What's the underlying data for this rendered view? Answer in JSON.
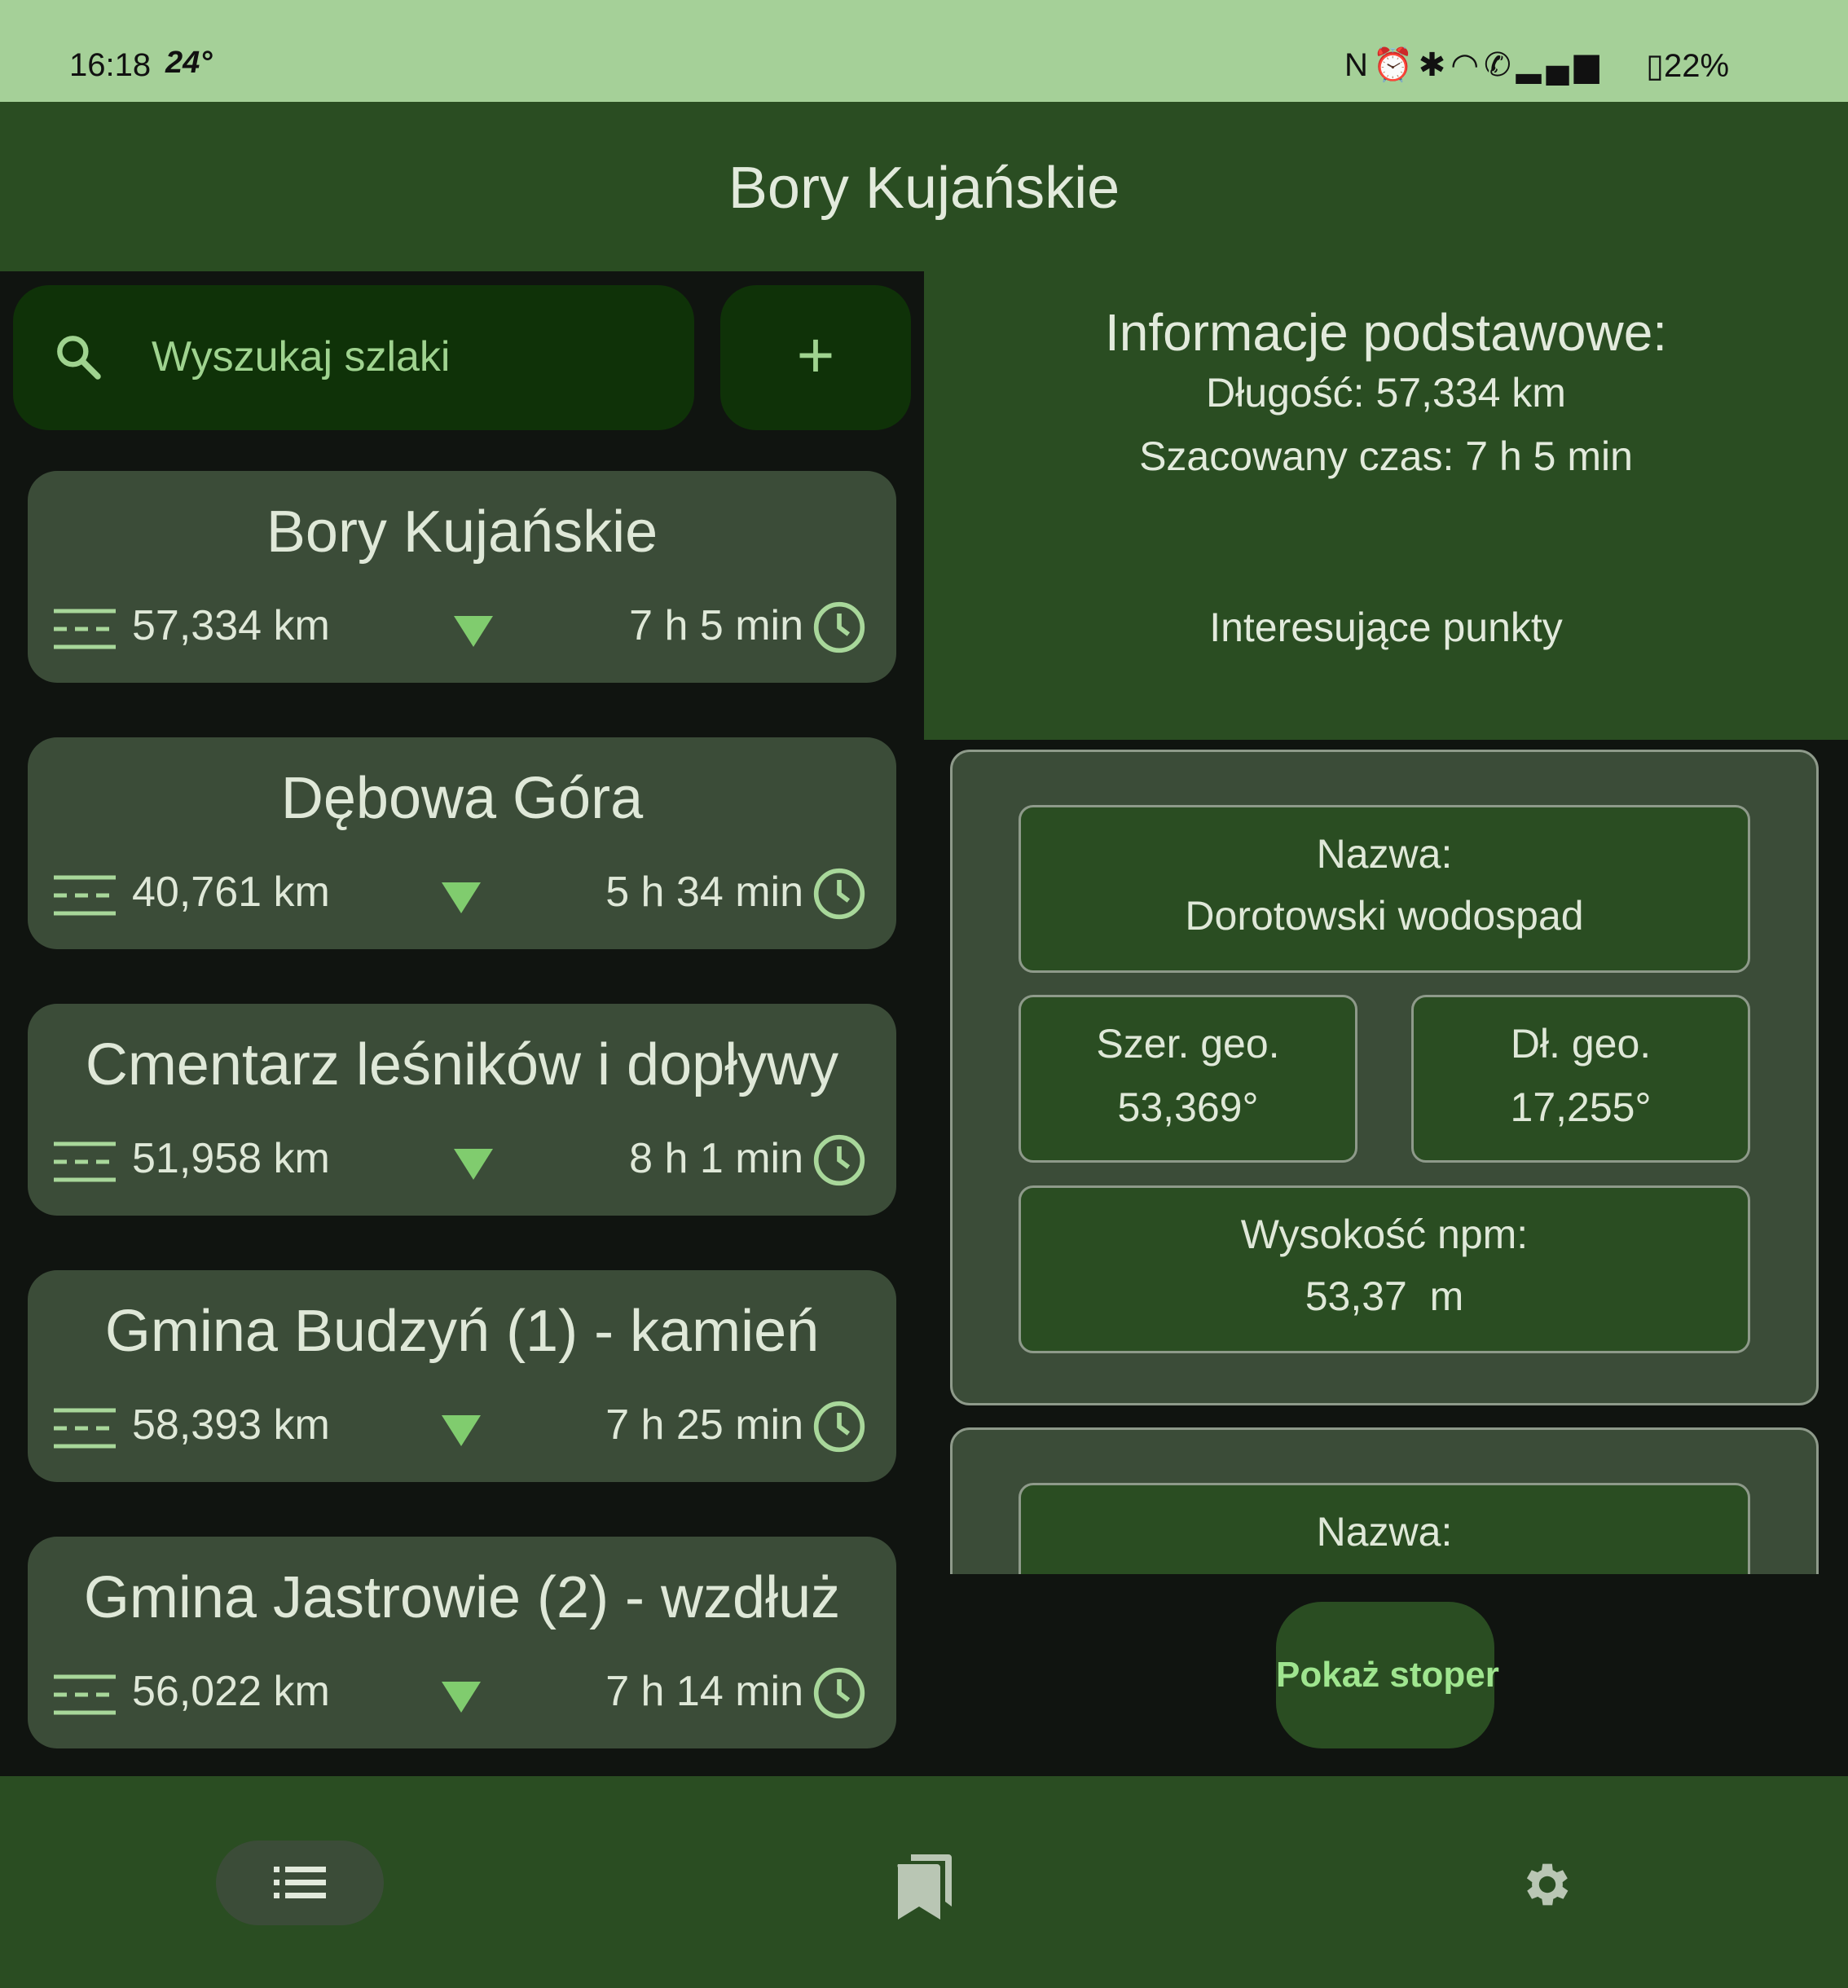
{
  "status_bar": {
    "time": "16:18",
    "temperature": "24°",
    "icons": [
      "nfc-icon",
      "alarm-icon",
      "bluetooth-icon",
      "wifi-icon",
      "wifi-call-icon",
      "signal-icon",
      "battery-icon"
    ],
    "battery": "22%"
  },
  "app_bar": {
    "title": "Bory Kujańskie"
  },
  "search": {
    "placeholder": "Wyszukaj szlaki"
  },
  "add_button": {
    "label": "+"
  },
  "trails": [
    {
      "name": "Bory Kujańskie",
      "length": "57,334 km",
      "time": "7 h 5 min"
    },
    {
      "name": "Dębowa Góra",
      "length": "40,761 km",
      "time": "5 h 34 min"
    },
    {
      "name": "Cmentarz leśników i dopływy",
      "length": "51,958 km",
      "time": "8 h 1 min"
    },
    {
      "name": "Gmina Budzyń (1) - kamień",
      "length": "58,393 km",
      "time": "7 h 25 min"
    },
    {
      "name": "Gmina Jastrowie (2) - wzdłuż",
      "length": "56,022 km",
      "time": "7 h 14 min"
    }
  ],
  "info": {
    "heading": "Informacje podstawowe:",
    "length_line": "Długość: 57,334 km",
    "time_line": "Szacowany czas: 7 h 5 min",
    "poi_heading": "Interesujące punkty"
  },
  "poi_list": [
    {
      "name_label": "Nazwa:",
      "name": "Dorotowski wodospad",
      "lat_label": "Szer. geo.",
      "lat": "53,369°",
      "lon_label": "Dł. geo.",
      "lon": "17,255°",
      "alt_label": "Wysokość npm:",
      "alt": "53,37  m"
    },
    {
      "name_label": "Nazwa:"
    }
  ],
  "stopwatch_button": {
    "label": "Pokaż stoper"
  },
  "bottom_nav": [
    {
      "icon": "list-icon",
      "active": true
    },
    {
      "icon": "bookmarks-icon",
      "active": false
    },
    {
      "icon": "gear-icon",
      "active": false
    }
  ],
  "colors": {
    "status_bar": "#a5d098",
    "app_bar": "#2a4d22",
    "background": "#101410",
    "card": "#3b4c38",
    "accent": "#80cc6e",
    "accent_text": "#9fd38f"
  }
}
